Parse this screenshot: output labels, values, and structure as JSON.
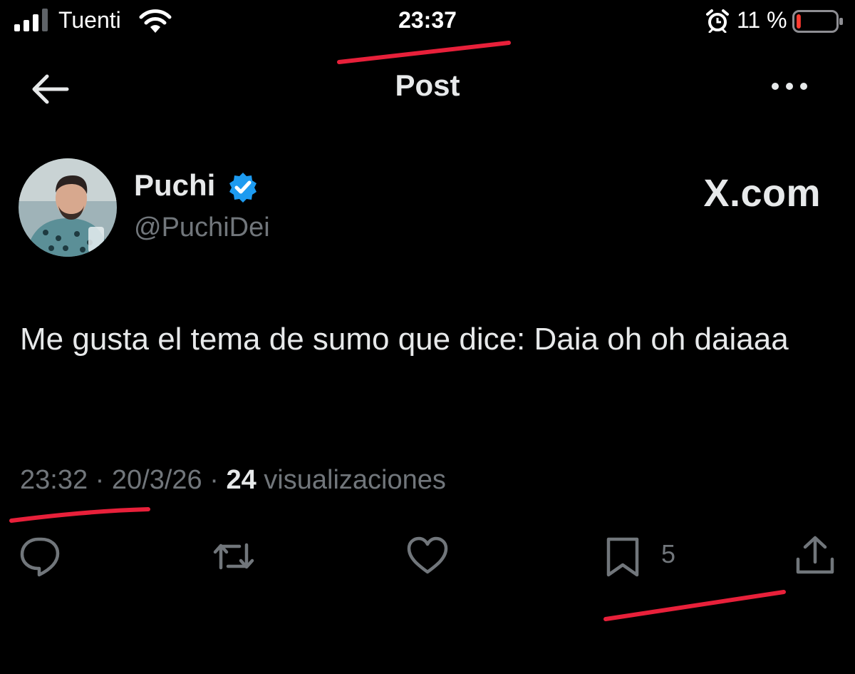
{
  "status_bar": {
    "carrier": "Tuenti",
    "time": "23:37",
    "battery_percent": "11 %",
    "battery_level": 0.11,
    "icons": [
      "signal-icon",
      "wifi-icon",
      "alarm-icon",
      "battery-icon"
    ]
  },
  "nav": {
    "title": "Post",
    "back_icon": "arrow-left-icon",
    "more_icon": "more-horizontal-icon"
  },
  "author": {
    "display_name": "Puchi",
    "handle": "@PuchiDei",
    "verified_icon": "verified-badge-icon"
  },
  "watermark": "X.com",
  "post": {
    "text": "Me gusta el tema de sumo que dice: Daia oh oh daiaaa"
  },
  "meta": {
    "time": "23:32",
    "separator": "·",
    "date": "20/3/26",
    "views_count": "24",
    "views_label": "visualizaciones"
  },
  "actions": {
    "reply_icon": "reply-icon",
    "repost_icon": "repost-icon",
    "like_icon": "heart-icon",
    "bookmark_icon": "bookmark-icon",
    "bookmark_count": "5",
    "share_icon": "share-icon"
  },
  "colors": {
    "background": "#000000",
    "text_primary": "#e7e9ea",
    "text_secondary": "#71767b",
    "verified_blue": "#1d9bf0",
    "annotation_red": "#e8203a",
    "battery_red": "#ff3b30"
  }
}
